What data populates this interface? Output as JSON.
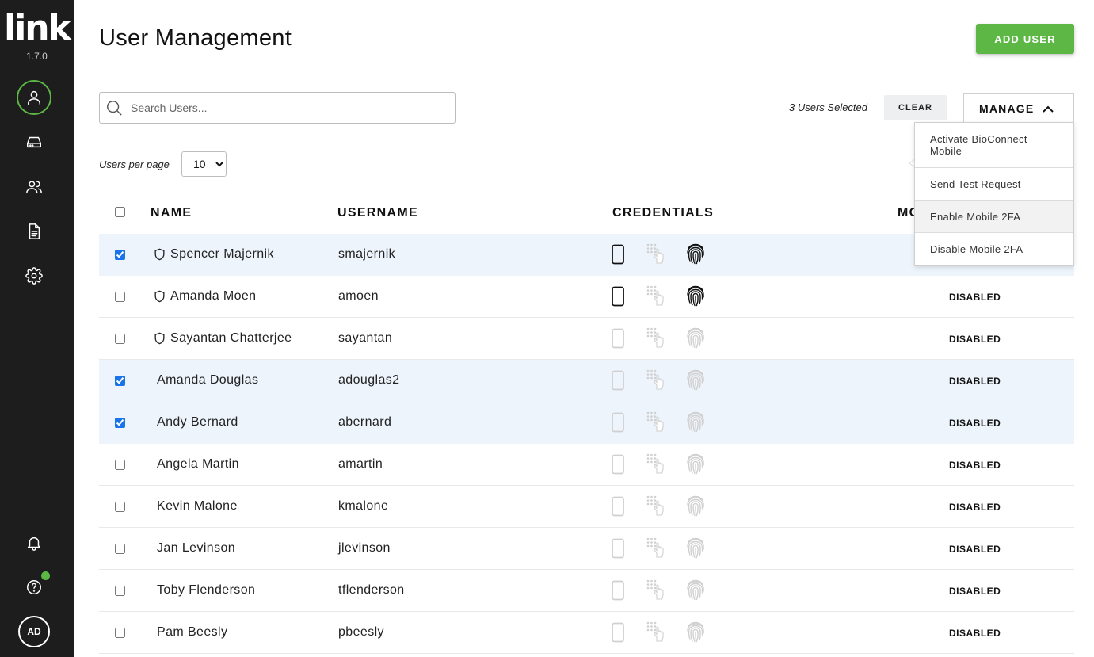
{
  "app": {
    "logo": "link",
    "version": "1.7.0"
  },
  "sidebar": {
    "items": [
      {
        "icon": "user-icon",
        "active": true
      },
      {
        "icon": "device-icon",
        "active": false
      },
      {
        "icon": "users-group-icon",
        "active": false
      },
      {
        "icon": "document-icon",
        "active": false
      },
      {
        "icon": "gear-icon",
        "active": false
      }
    ],
    "bottom": {
      "bell": "bell-icon",
      "help": "help-icon",
      "avatar_initials": "AD"
    }
  },
  "header": {
    "title": "User Management",
    "add_user_label": "ADD USER"
  },
  "search": {
    "placeholder": "Search Users..."
  },
  "selection": {
    "text": "3 Users Selected",
    "clear_label": "CLEAR"
  },
  "manage": {
    "label": "MANAGE",
    "menu": [
      "Activate BioConnect Mobile",
      "Send Test Request",
      "Enable Mobile 2FA",
      "Disable Mobile 2FA"
    ],
    "highlighted_index": 2
  },
  "pagination": {
    "per_page_label": "Users per page",
    "per_page_value": "10",
    "options": [
      "10"
    ]
  },
  "table": {
    "headers": {
      "name": "NAME",
      "username": "USERNAME",
      "credentials": "CREDENTIALS",
      "mobile": "MO"
    },
    "rows": [
      {
        "name": "Spencer Majernik",
        "username": "smajernik",
        "admin": true,
        "selected": true,
        "phone": true,
        "touch": false,
        "finger": true,
        "status": ""
      },
      {
        "name": "Amanda Moen",
        "username": "amoen",
        "admin": true,
        "selected": false,
        "phone": true,
        "touch": false,
        "finger": true,
        "status": "DISABLED"
      },
      {
        "name": "Sayantan Chatterjee",
        "username": "sayantan",
        "admin": true,
        "selected": false,
        "phone": false,
        "touch": false,
        "finger": false,
        "status": "DISABLED"
      },
      {
        "name": "Amanda Douglas",
        "username": "adouglas2",
        "admin": false,
        "selected": true,
        "phone": false,
        "touch": false,
        "finger": false,
        "status": "DISABLED"
      },
      {
        "name": "Andy Bernard",
        "username": "abernard",
        "admin": false,
        "selected": true,
        "phone": false,
        "touch": false,
        "finger": false,
        "status": "DISABLED"
      },
      {
        "name": "Angela Martin",
        "username": "amartin",
        "admin": false,
        "selected": false,
        "phone": false,
        "touch": false,
        "finger": false,
        "status": "DISABLED"
      },
      {
        "name": "Kevin Malone",
        "username": "kmalone",
        "admin": false,
        "selected": false,
        "phone": false,
        "touch": false,
        "finger": false,
        "status": "DISABLED"
      },
      {
        "name": "Jan Levinson",
        "username": "jlevinson",
        "admin": false,
        "selected": false,
        "phone": false,
        "touch": false,
        "finger": false,
        "status": "DISABLED"
      },
      {
        "name": "Toby Flenderson",
        "username": "tflenderson",
        "admin": false,
        "selected": false,
        "phone": false,
        "touch": false,
        "finger": false,
        "status": "DISABLED"
      },
      {
        "name": "Pam Beesly",
        "username": "pbeesly",
        "admin": false,
        "selected": false,
        "phone": false,
        "touch": false,
        "finger": false,
        "status": "DISABLED"
      }
    ]
  },
  "colors": {
    "accent": "#5cb745",
    "sidebar_bg": "#1d1d1d",
    "selected_row": "#edf4fc",
    "credential_active": "#111111",
    "credential_inactive": "#d0d0d0"
  }
}
